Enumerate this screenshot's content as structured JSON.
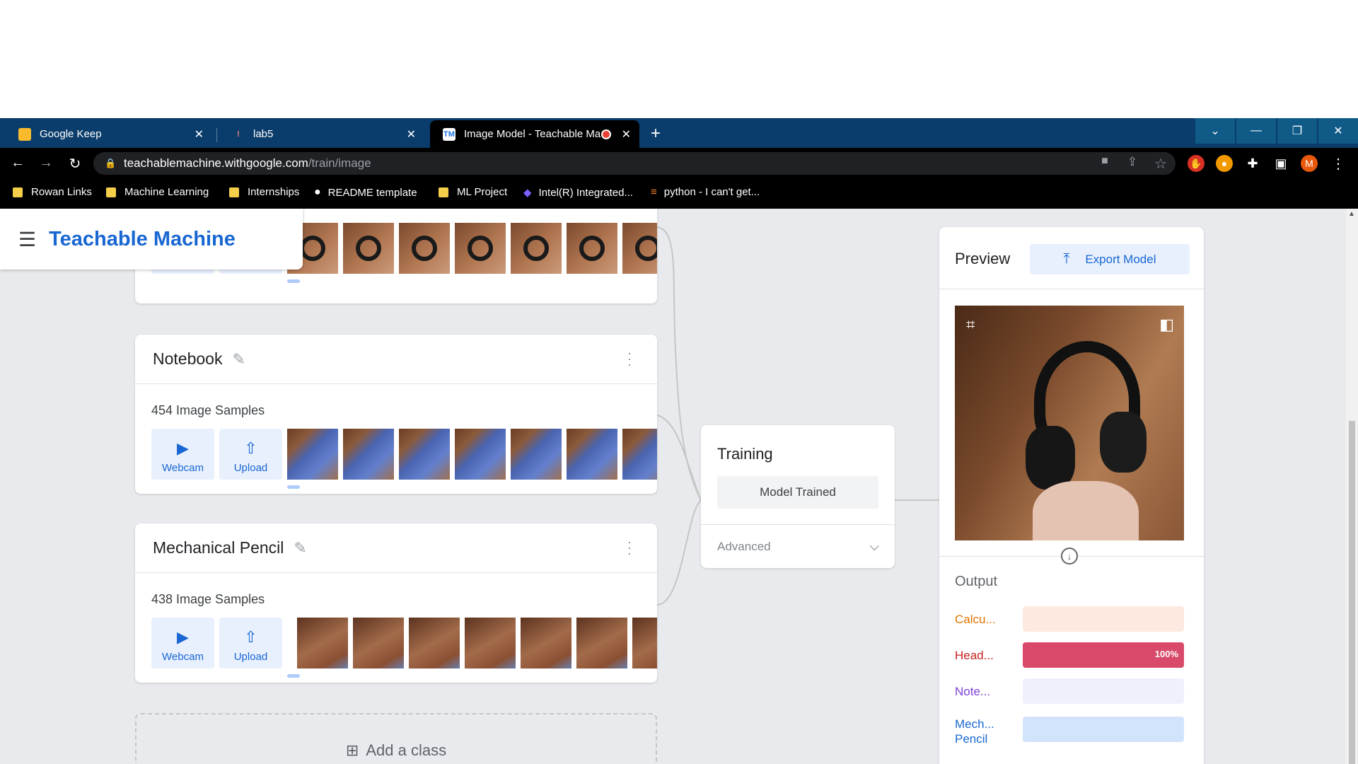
{
  "browser": {
    "tabs": [
      {
        "title": "Google Keep",
        "fav_color": "#f9bb2d",
        "fav_glyph": ""
      },
      {
        "title": "lab5",
        "fav_color": "#0a3d6b",
        "fav_glyph": "!"
      },
      {
        "title": "Image Model - Teachable Ma",
        "fav_color": "#ffffff",
        "fav_glyph": "TM"
      }
    ],
    "new_tab": "+",
    "url_host": "teachablemachine.withgoogle.com",
    "url_path": "/train/image",
    "bookmarks": [
      "Rowan Links",
      "Machine Learning",
      "Internships",
      "README template",
      "ML Project",
      "Intel(R) Integrated...",
      "python - I can't get..."
    ],
    "profile_initial": "M"
  },
  "app": {
    "brand": "Teachable Machine"
  },
  "classes": [
    {
      "name": "Notebook",
      "samples": "454 Image Samples"
    },
    {
      "name": "Mechanical Pencil",
      "samples": "438 Image Samples"
    }
  ],
  "buttons": {
    "webcam": "Webcam",
    "upload": "Upload"
  },
  "add_class": "Add a class",
  "training": {
    "title": "Training",
    "status": "Model Trained",
    "advanced": "Advanced"
  },
  "preview": {
    "title": "Preview",
    "export": "Export Model",
    "output_title": "Output",
    "outputs": [
      {
        "label": "Calcu...",
        "label2": "",
        "color": "#e37400",
        "track": "#fde9e0",
        "fill": "#fde9e0",
        "value": 0,
        "pct": ""
      },
      {
        "label": "Head...",
        "label2": "",
        "color": "#c5221f",
        "track": "#fce8ec",
        "fill": "#d94a6a",
        "value": 1,
        "pct": "100%"
      },
      {
        "label": "Note...",
        "label2": "",
        "color": "#7b3fd6",
        "track": "#f0effc",
        "fill": "#f0effc",
        "value": 0,
        "pct": ""
      },
      {
        "label": "Mech...",
        "label2": "Pencil",
        "color": "#1967d2",
        "track": "#d2e3fc",
        "fill": "#d2e3fc",
        "value": 0,
        "pct": ""
      }
    ]
  }
}
